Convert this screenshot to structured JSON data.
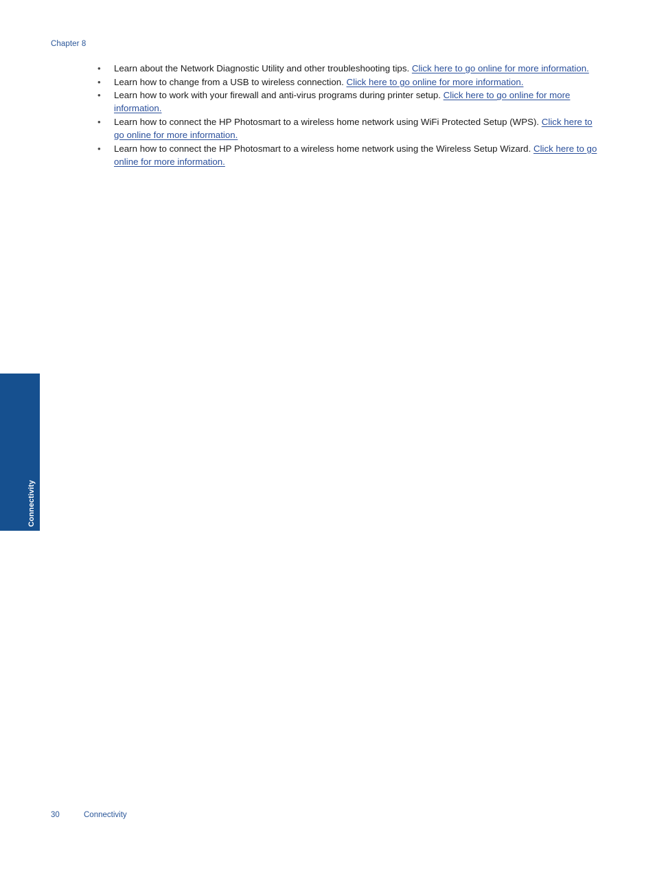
{
  "header": {
    "chapter_label": "Chapter 8"
  },
  "tab": {
    "label": "Connectivity",
    "color": "#16508f"
  },
  "colors": {
    "accent_blue": "#16508f",
    "header_blue": "#2a5699",
    "link_blue": "#2a4f9b",
    "body_text": "#1a1a1a",
    "page_background": "#ffffff"
  },
  "bullet_mark": "•",
  "content": {
    "bullets": [
      {
        "lead": "Learn about the Network Diagnostic Utility and other troubleshooting tips. ",
        "link": "Click here to go online for more information."
      },
      {
        "lead": "Learn how to change from a USB to wireless connection. ",
        "link": "Click here to go online for more information."
      },
      {
        "lead": "Learn how to work with your firewall and anti-virus programs during printer setup. ",
        "link": "Click here to go online for more information."
      },
      {
        "lead": "Learn how to connect the HP Photosmart to a wireless home network using WiFi Protected Setup (WPS). ",
        "link": "Click here to go online for more information."
      },
      {
        "lead": "Learn how to connect the HP Photosmart to a wireless home network using the Wireless Setup Wizard. ",
        "link": "Click here to go online for more information."
      }
    ]
  },
  "footer": {
    "page_number": "30",
    "section_name": "Connectivity"
  }
}
